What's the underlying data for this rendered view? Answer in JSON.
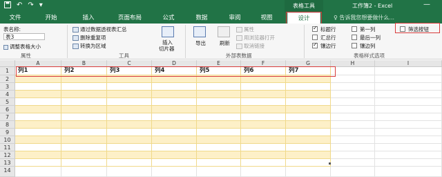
{
  "titlebar": {
    "save_icon": "save-icon",
    "undo_glyph": "↶",
    "redo_glyph": "↷",
    "context_title": "表格工具",
    "doc_title": "工作簿2 - Excel",
    "minimize_glyph": "—"
  },
  "tabs": [
    {
      "label": "文件"
    },
    {
      "label": "开始"
    },
    {
      "label": "插入"
    },
    {
      "label": "页面布局"
    },
    {
      "label": "公式"
    },
    {
      "label": "数据"
    },
    {
      "label": "审阅"
    },
    {
      "label": "视图"
    },
    {
      "label": "设计",
      "active": true
    }
  ],
  "tell_me": "♀ 告诉我您想要做什么...",
  "ribbon": {
    "properties": {
      "name_label": "表名称:",
      "name_value": "表3",
      "resize_label": "调整表格大小",
      "group_label": "属性"
    },
    "tools": {
      "pivot_label": "通过数据透视表汇总",
      "dedupe_label": "删除重复项",
      "convert_label": "转换为区域",
      "slicer_label_1": "插入",
      "slicer_label_2": "切片器",
      "group_label": "工具"
    },
    "external": {
      "export_label": "导出",
      "refresh_label": "刷新",
      "props_label": "属性",
      "browser_label": "用浏览器打开",
      "unlink_label": "取消链接",
      "group_label": "外部表数据"
    },
    "style_options": {
      "header_row": {
        "label": "标题行",
        "checked": true
      },
      "total_row": {
        "label": "汇总行",
        "checked": false
      },
      "banded_rows": {
        "label": "镶边行",
        "checked": true
      },
      "first_col": {
        "label": "第一列",
        "checked": false
      },
      "last_col": {
        "label": "最后一列",
        "checked": false
      },
      "banded_cols": {
        "label": "镶边列",
        "checked": false
      },
      "filter_button": {
        "label": "筛选按钮",
        "checked": false
      },
      "group_label": "表格样式选项"
    }
  },
  "sheet": {
    "columns": [
      "A",
      "B",
      "C",
      "D",
      "E",
      "F",
      "G",
      "H",
      "I"
    ],
    "rows": [
      "1",
      "2",
      "3",
      "4",
      "5",
      "6",
      "7",
      "8",
      "9",
      "10",
      "11",
      "12",
      "13",
      "14"
    ],
    "table_headers": [
      "列1",
      "列2",
      "列3",
      "列4",
      "列5",
      "列6",
      "列7"
    ],
    "band_color": "#fdf0c8",
    "accent_red": "#d83b3b",
    "brand_green": "#217346"
  }
}
